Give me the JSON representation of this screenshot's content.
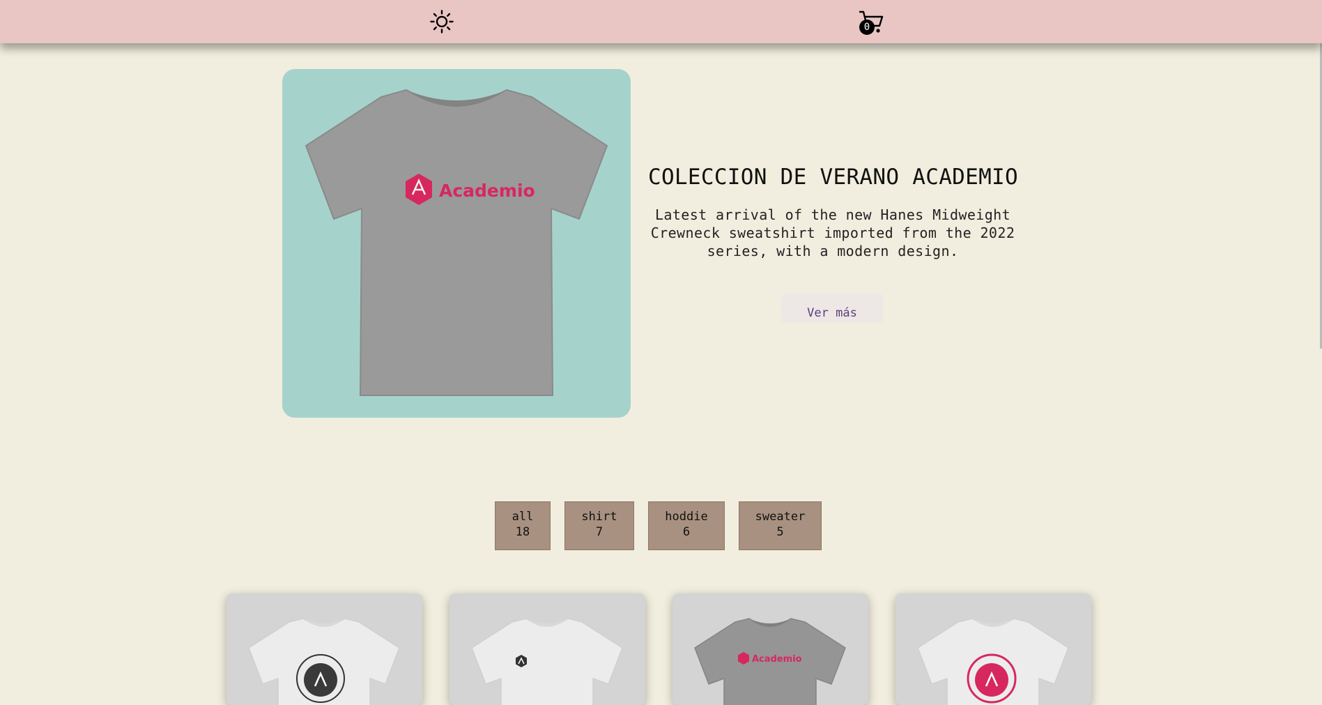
{
  "header": {
    "theme_icon": "sun-icon",
    "cart_icon": "cart-icon",
    "cart_count": "0",
    "background_color": "#e9c5c4"
  },
  "hero": {
    "image_brand_text": "Academio",
    "title": "COLECCION DE VERANO ACADEMIO",
    "description": "Latest arrival of the new Hanes Midweight Crewneck sweatshirt imported from the 2022 series, with a modern design.",
    "button_label": "Ver más",
    "image_background": "#a6d2cc"
  },
  "filters": [
    {
      "label": "all",
      "count": "18"
    },
    {
      "label": "shirt",
      "count": "7"
    },
    {
      "label": "hoddie",
      "count": "6"
    },
    {
      "label": "sweater",
      "count": "5"
    }
  ],
  "products": [
    {
      "shirt_color": "white",
      "logo": "round-badge-dark"
    },
    {
      "shirt_color": "white",
      "logo": "small-hexagon-dark"
    },
    {
      "shirt_color": "gray",
      "logo": "academio-wordmark",
      "brand_text": "Academio"
    },
    {
      "shirt_color": "white",
      "logo": "round-badge-pink"
    }
  ],
  "colors": {
    "page_background": "#f2eedf",
    "brand_pink": "#d6285f",
    "filter_background": "#a89180",
    "card_background": "#d4d4d4"
  }
}
